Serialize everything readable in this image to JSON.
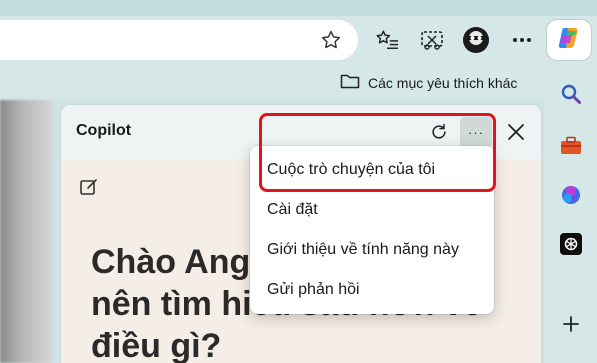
{
  "toolbar": {
    "icons": [
      "favorite-star-icon",
      "favorites-list-icon",
      "screenshot-icon",
      "profile-avatar-icon",
      "more-options-icon",
      "copilot-icon"
    ]
  },
  "favorites_bar": {
    "other_favorites_label": "Các mục yêu thích khác"
  },
  "copilot_pane": {
    "title": "Copilot",
    "more_label": "···",
    "greeting": "Chào Angela, chúng ta nên tìm hiểu sâu hơn về điều gì?"
  },
  "menu": {
    "items": [
      {
        "label": "Cuộc trò chuyện của tôi"
      },
      {
        "label": "Cài đặt"
      },
      {
        "label": "Giới thiệu về tính năng này"
      },
      {
        "label": "Gửi phản hồi"
      }
    ]
  },
  "sidebar": {
    "icons": [
      "search-icon",
      "toolbox-icon",
      "office-icon",
      "chatgpt-icon",
      "add-icon"
    ]
  },
  "colors": {
    "highlight": "#e0141e",
    "chrome_bg": "#d5e7e7",
    "pane_body_bg": "#f5eee6"
  }
}
